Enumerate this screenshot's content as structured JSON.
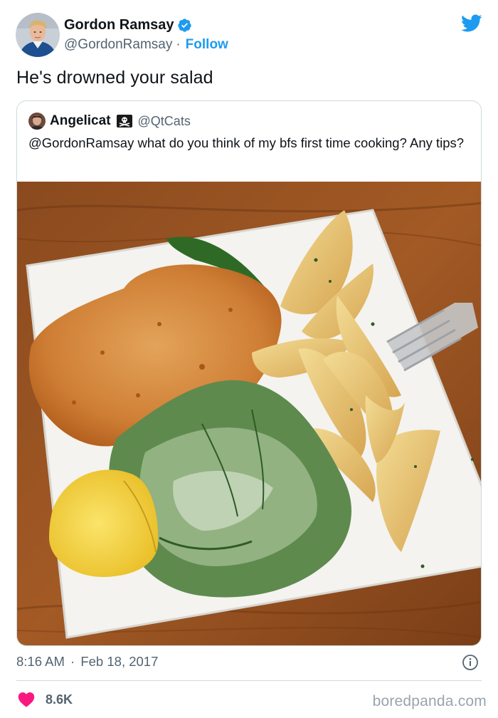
{
  "author": {
    "name": "Gordon Ramsay",
    "handle": "@GordonRamsay",
    "separator": "·",
    "follow_label": "Follow",
    "avatar_icon": "user-avatar-photo",
    "verified_icon": "verified-badge-icon"
  },
  "brand": {
    "icon": "twitter-bird-icon",
    "color": "#1d9bf0"
  },
  "tweet": {
    "text": "He's drowned your salad"
  },
  "quoted": {
    "name": "Angelicat",
    "emoji_icon": "skull-crossbones-flag-icon",
    "handle": "@QtCats",
    "text": "@GordonRamsay what do you think of my bfs first time cooking? Any tips?",
    "photo_icon": "food-plate-photo"
  },
  "footer": {
    "time": "8:16 AM",
    "separator": "·",
    "date": "Feb 18, 2017",
    "info_icon": "info-icon",
    "like_icon": "heart-icon",
    "like_count": "8.6K",
    "heart_color": "#f91880"
  },
  "watermark": "boredpanda.com"
}
